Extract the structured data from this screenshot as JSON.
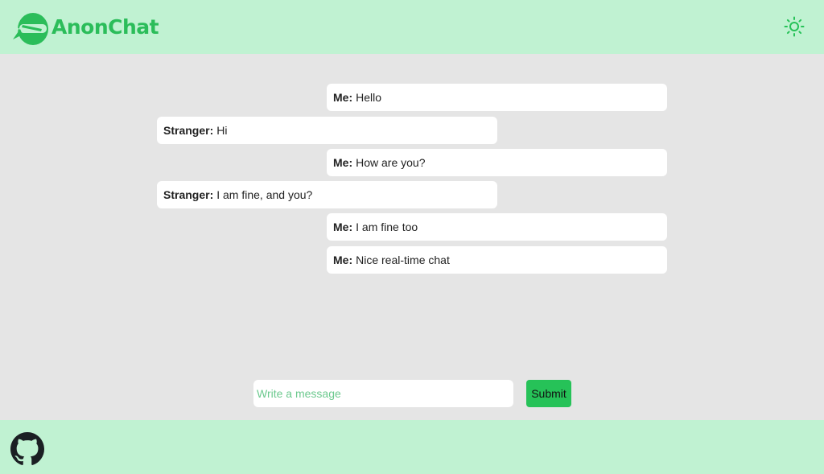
{
  "header": {
    "brand": "AnonChat",
    "logo_icon": "ninja-mask-icon",
    "theme_toggle_icon": "sun-icon"
  },
  "messages": [
    {
      "from": "me",
      "sender": "Me:",
      "text": "Hello"
    },
    {
      "from": "stranger",
      "sender": "Stranger:",
      "text": "Hi"
    },
    {
      "from": "me",
      "sender": "Me:",
      "text": "How are you?"
    },
    {
      "from": "stranger",
      "sender": "Stranger:",
      "text": "I am fine, and you?"
    },
    {
      "from": "me",
      "sender": "Me:",
      "text": "I am fine too"
    },
    {
      "from": "me",
      "sender": "Me:",
      "text": "Nice real-time chat"
    }
  ],
  "composer": {
    "placeholder": "Write a message",
    "value": "",
    "submit_label": "Submit"
  },
  "footer": {
    "github_icon": "github-icon"
  },
  "colors": {
    "accent": "#26c258",
    "brand": "#2bbd5a",
    "bar_background": "#c0f2d2",
    "page_background": "#e5e5e5"
  }
}
